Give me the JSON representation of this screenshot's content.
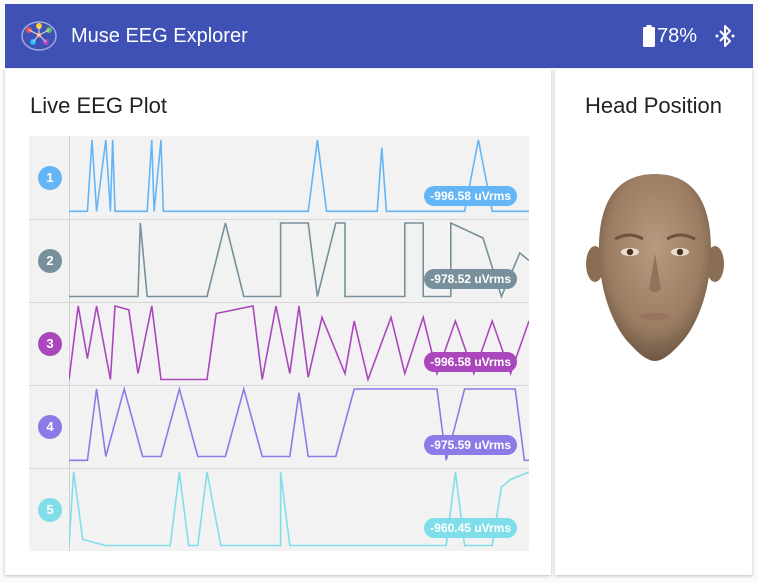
{
  "app": {
    "title": "Muse EEG Explorer",
    "battery": "78%",
    "logo_icon": "brain-circuit-icon",
    "battery_icon": "battery-icon",
    "bluetooth_icon": "bluetooth-connected-icon"
  },
  "plot": {
    "title": "Live EEG Plot",
    "channels": [
      {
        "number": "1",
        "color": "#64b5f6",
        "reading": "-996.58 uVrms"
      },
      {
        "number": "2",
        "color": "#78909c",
        "reading": "-978.52 uVrms"
      },
      {
        "number": "3",
        "color": "#ab47bc",
        "reading": "-996.58 uVrms"
      },
      {
        "number": "4",
        "color": "#8c7ae6",
        "reading": "-975.59 uVrms"
      },
      {
        "number": "5",
        "color": "#80deea",
        "reading": "-960.45 uVrms"
      }
    ]
  },
  "head": {
    "title": "Head Position"
  },
  "colors": {
    "appbar": "#3f51b5"
  }
}
